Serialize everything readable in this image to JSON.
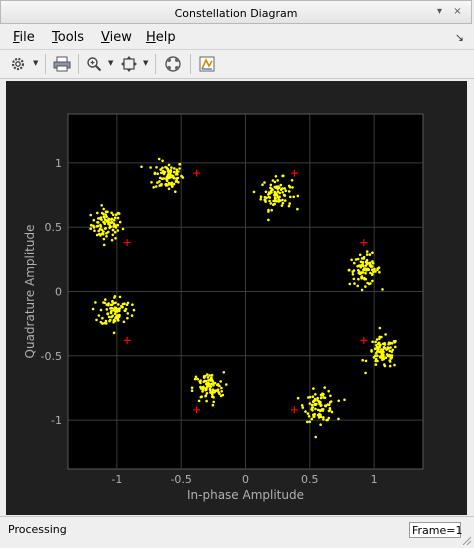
{
  "window": {
    "title": "Constellation Diagram"
  },
  "menu": [
    {
      "label": "File",
      "mnemonic": "F",
      "rest": "ile"
    },
    {
      "label": "Tools",
      "mnemonic": "T",
      "rest": "ools"
    },
    {
      "label": "View",
      "mnemonic": "V",
      "rest": "iew"
    },
    {
      "label": "Help",
      "mnemonic": "H",
      "rest": "elp"
    }
  ],
  "toolbar": {
    "icons": [
      "settings-gear-icon",
      "print-icon",
      "zoom-in-icon",
      "zoom-to-fit-icon",
      "signal-scatter-icon",
      "measurement-icon"
    ]
  },
  "status": {
    "text": "Processing",
    "frame": "Frame=1"
  },
  "chart_data": {
    "type": "scatter",
    "title": "",
    "xlabel": "In-phase Amplitude",
    "ylabel": "Quadrature Amplitude",
    "xlim": [
      -1.38,
      1.38
    ],
    "ylim": [
      -1.38,
      1.38
    ],
    "xticks": [
      -1,
      -0.5,
      0,
      0.5,
      1
    ],
    "yticks": [
      -1,
      -0.5,
      0,
      0.5,
      1
    ],
    "grid": true,
    "background": "#000000",
    "series": [
      {
        "kind": "received",
        "color": "#ffff00",
        "cluster_centers": [
          [
            -1.08,
            0.52
          ],
          [
            -0.6,
            0.9
          ],
          [
            0.24,
            0.76
          ],
          [
            0.93,
            0.17
          ],
          [
            1.07,
            -0.48
          ],
          [
            0.58,
            -0.89
          ],
          [
            -0.29,
            -0.75
          ],
          [
            -1.01,
            -0.15
          ]
        ],
        "cluster_spread": 0.06,
        "points_per_cluster": 90
      },
      {
        "kind": "reference",
        "color": "#ff0000",
        "marker": "+",
        "points": [
          [
            -0.38,
            0.92
          ],
          [
            0.38,
            0.92
          ],
          [
            0.92,
            0.38
          ],
          [
            0.92,
            -0.38
          ],
          [
            0.38,
            -0.92
          ],
          [
            -0.38,
            -0.92
          ],
          [
            -0.92,
            -0.38
          ],
          [
            -0.92,
            0.38
          ]
        ]
      }
    ]
  }
}
